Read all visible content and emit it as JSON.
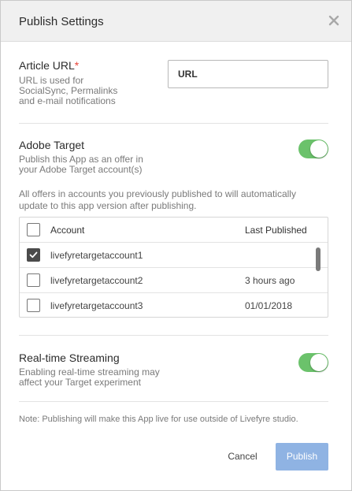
{
  "dialog": {
    "title": "Publish Settings",
    "close_icon": "close-icon"
  },
  "article_url": {
    "label": "Article URL",
    "required_mark": "*",
    "help_lines": [
      "URL is used for",
      "SocialSync, Permalinks",
      "and e-mail notifications"
    ],
    "input_value": "URL"
  },
  "adobe_target": {
    "label": "Adobe Target",
    "help_lines": [
      "Publish this App as an offer in",
      "your Adobe Target account(s)"
    ],
    "enabled": true,
    "info_lines": [
      "All offers in accounts you previously published to will automatically",
      "update to this app version after publishing."
    ]
  },
  "accounts_table": {
    "headers": {
      "account": "Account",
      "last_published": "Last Published"
    },
    "rows": [
      {
        "account": "livefyretargetaccount1",
        "last_published": "",
        "checked": true
      },
      {
        "account": "livefyretargetaccount2",
        "last_published": "3 hours ago",
        "checked": false
      },
      {
        "account": "livefyretargetaccount3",
        "last_published": "01/01/2018",
        "checked": false
      }
    ]
  },
  "realtime_streaming": {
    "label": "Real-time Streaming",
    "help_lines": [
      "Enabling real-time streaming may",
      "affect your Target experiment"
    ],
    "enabled": true
  },
  "note": "Note: Publishing will make this App live for use outside of Livefyre studio.",
  "footer": {
    "cancel_label": "Cancel",
    "publish_label": "Publish"
  },
  "colors": {
    "toggle_on": "#6bc26b",
    "publish_button": "#8fb3e3",
    "required": "#e8463a"
  }
}
